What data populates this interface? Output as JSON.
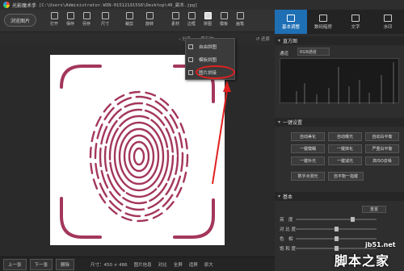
{
  "titlebar": {
    "app_name": "光影魔术手",
    "file_path": "[C:\\Users\\Administrator.WIN-015121915S6\\Desktop\\40_副本.jpg]"
  },
  "toolbar": {
    "browse_label": "浏览图片",
    "tools": [
      {
        "label": "打开",
        "icon": "open-icon"
      },
      {
        "label": "保存",
        "icon": "save-icon"
      },
      {
        "label": "另存",
        "icon": "save-as-icon"
      },
      {
        "label": "尺寸",
        "icon": "resize-icon"
      },
      {
        "label": "裁剪",
        "icon": "crop-icon"
      },
      {
        "label": "旋转",
        "icon": "rotate-icon"
      },
      {
        "label": "素材",
        "icon": "material-icon"
      },
      {
        "label": "边框",
        "icon": "frame-icon"
      },
      {
        "label": "拼图",
        "icon": "collage-icon"
      },
      {
        "label": "模板",
        "icon": "template-icon"
      },
      {
        "label": "画笔",
        "icon": "brush-icon"
      }
    ]
  },
  "subbar": {
    "share_label": "分享",
    "save_as_label": "保存的",
    "restore_label": "还原"
  },
  "popup": {
    "items": [
      {
        "label": "自由拼图",
        "icon": "free-collage-icon"
      },
      {
        "label": "模板拼图",
        "icon": "template-collage-icon"
      },
      {
        "label": "图片拼接",
        "icon": "image-stitch-icon"
      }
    ]
  },
  "statusbar": {
    "prev_label": "上一张",
    "next_label": "下一张",
    "delete_label": "删除",
    "size_text": "尺寸：450 × 486",
    "info_label": "图片信息",
    "compare_label": "对比",
    "fullscreen_label": "全屏",
    "zoom_label": "适屏",
    "original_label": "原大"
  },
  "right_tabs": [
    {
      "label": "基本调整",
      "icon": "basic-adjust-icon",
      "active": true
    },
    {
      "label": "数码暗房",
      "icon": "darkroom-icon",
      "active": false
    },
    {
      "label": "文字",
      "icon": "text-icon",
      "active": false
    },
    {
      "label": "水印",
      "icon": "watermark-icon",
      "active": false
    }
  ],
  "histogram": {
    "title": "直方图",
    "channel_label": "通道",
    "channel_value": "RGB通道"
  },
  "one_click": {
    "title": "一键设置",
    "buttons": [
      "自动美化",
      "自动曝光",
      "自动白平衡",
      "一键模糊",
      "一键抹化",
      "严重白平衡",
      "一键补光",
      "一键减光",
      "高ISO去噪",
      "数字点测光",
      "自平衡一指键"
    ]
  },
  "basic": {
    "title": "基本",
    "reset_label": "重置",
    "rows": [
      {
        "label": "亮　度",
        "level": 0.72
      },
      {
        "label": "对 比 度",
        "level": 0.5
      },
      {
        "label": "色　相",
        "level": 0.5
      },
      {
        "label": "饱 和 度",
        "level": 0.5
      }
    ]
  },
  "watermark": {
    "site": "jb51.net",
    "name": "脚本之家"
  },
  "colors": {
    "accent": "#1e6fb4",
    "fingerprint": "#a3375a",
    "highlight": "#e02020"
  }
}
